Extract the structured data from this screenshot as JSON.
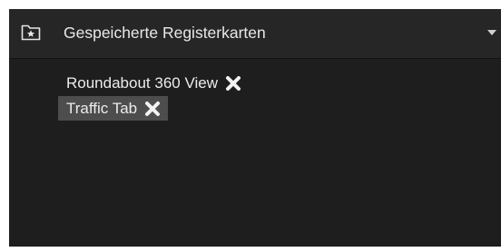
{
  "panel": {
    "title": "Gespeicherte Registerkarten",
    "icon": "folder-star-icon",
    "collapse_icon": "chevron-down-icon"
  },
  "saved_tabs": [
    {
      "label": "Roundabout 360 View",
      "selected": false,
      "close_icon": "close-icon"
    },
    {
      "label": "Traffic Tab",
      "selected": true,
      "close_icon": "close-icon"
    }
  ],
  "colors": {
    "panel_bg": "#1e1e1e",
    "header_bg": "#262626",
    "selected_bg": "#4d4d4d",
    "text": "#ececec"
  }
}
